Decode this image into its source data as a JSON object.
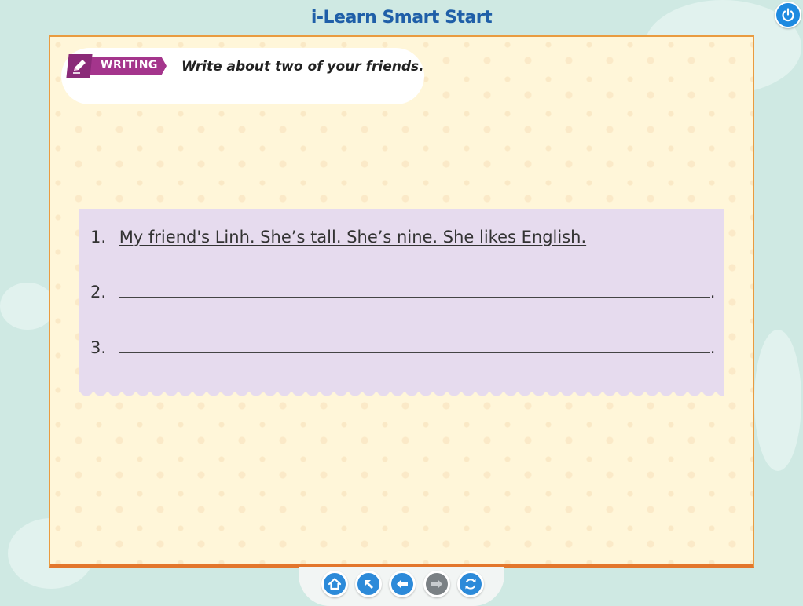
{
  "app": {
    "title": "i-Learn Smart Start"
  },
  "task": {
    "badge_label": "WRITING",
    "prompt": "Write about two of your friends."
  },
  "answers": [
    {
      "number": "1.",
      "text": "My friend's Linh. She’s tall. She’s nine. She likes English."
    },
    {
      "number": "2.",
      "text": "",
      "end": "."
    },
    {
      "number": "3.",
      "text": "",
      "end": "."
    }
  ],
  "navigation": {
    "buttons": [
      {
        "icon": "home-icon",
        "enabled": true
      },
      {
        "icon": "arrow-up-left-icon",
        "enabled": true
      },
      {
        "icon": "arrow-left-icon",
        "enabled": true
      },
      {
        "icon": "arrow-right-icon",
        "enabled": false
      },
      {
        "icon": "refresh-icon",
        "enabled": true
      }
    ]
  },
  "colors": {
    "title": "#1f5fa8",
    "badge": "#a4358c",
    "answer_box": "#e6dbee",
    "page_border": "#e99b40",
    "nav_button": "#2c8ad9",
    "nav_button_disabled": "#7a8084"
  }
}
